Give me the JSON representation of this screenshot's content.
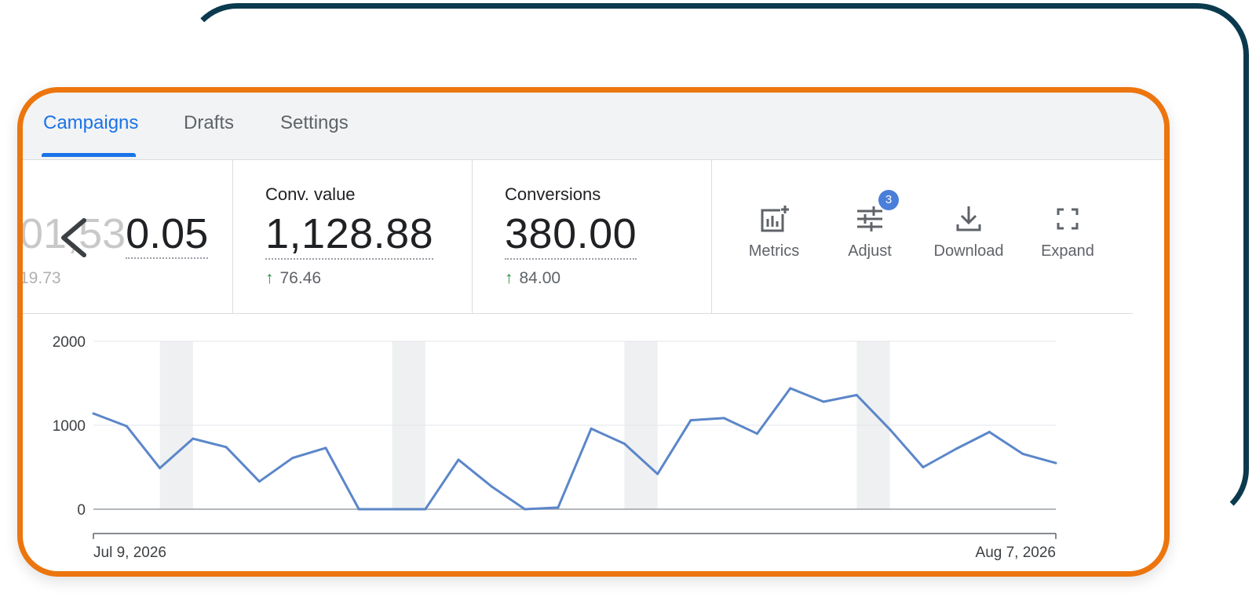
{
  "tabs": [
    {
      "label": "Campaigns",
      "active": true
    },
    {
      "label": "Drafts",
      "active": false
    },
    {
      "label": "Settings",
      "active": false
    }
  ],
  "scorecards": {
    "first": {
      "value_faded": "01,53",
      "value_visible": "0.05",
      "delta": "19.73"
    },
    "conv_value": {
      "label": "Conv. value",
      "value": "1,128.88",
      "delta": "76.46"
    },
    "conversions": {
      "label": "Conversions",
      "value": "380.00",
      "delta": "84.00"
    }
  },
  "toolbar": {
    "metrics": {
      "label": "Metrics",
      "icon": "metrics-icon"
    },
    "adjust": {
      "label": "Adjust",
      "icon": "adjust-icon",
      "badge": "3"
    },
    "download": {
      "label": "Download",
      "icon": "download-icon"
    },
    "expand": {
      "label": "Expand",
      "icon": "expand-icon"
    }
  },
  "colors": {
    "accent": "#1a73e8",
    "line": "#5b86c9",
    "positive": "#1e8e3e",
    "card_border": "#ec750e",
    "back_frame": "#0b3a4e"
  },
  "chart_data": {
    "type": "line",
    "x_start_label": "Jul 9, 2026",
    "x_end_label": "Aug 7, 2026",
    "ylim": [
      0,
      2000
    ],
    "yticks": [
      0,
      1000,
      2000
    ],
    "grid": true,
    "weekend_bands": [
      [
        2,
        3
      ],
      [
        9,
        10
      ],
      [
        16,
        17
      ],
      [
        23,
        24
      ]
    ],
    "series": [
      {
        "values": [
          1140,
          990,
          490,
          840,
          740,
          330,
          610,
          730,
          0,
          0,
          0,
          590,
          270,
          0,
          20,
          960,
          780,
          420,
          1060,
          1085,
          900,
          1440,
          1280,
          1360,
          950,
          500,
          720,
          920,
          660,
          550
        ]
      }
    ]
  }
}
